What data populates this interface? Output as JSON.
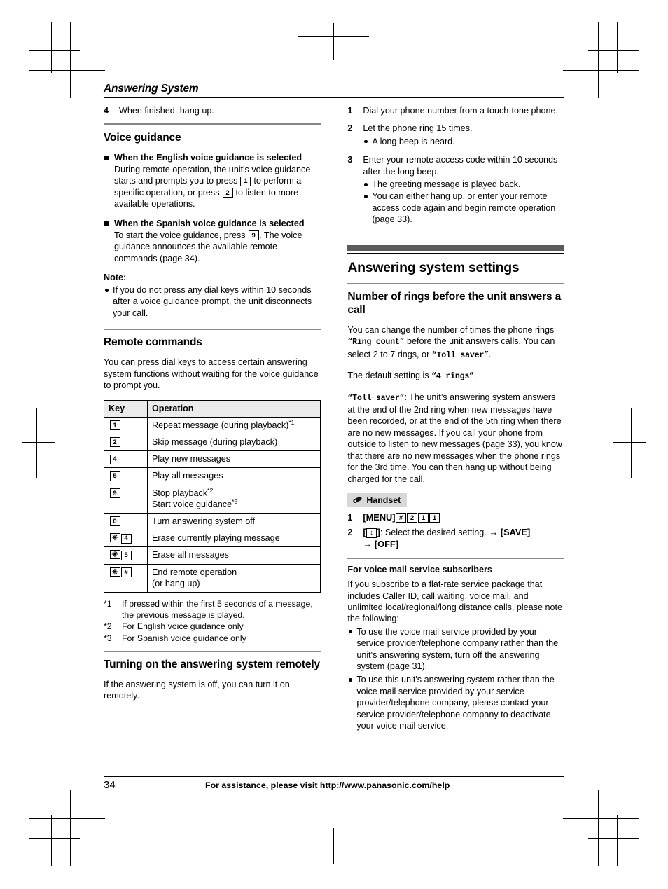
{
  "running_head": "Answering System",
  "left_column": {
    "step4": {
      "num": "4",
      "text": "When finished, hang up."
    },
    "voice_guidance": {
      "title": "Voice guidance",
      "blocks": [
        {
          "head": "When the English voice guidance is selected",
          "body_pre": "During remote operation, the unit's voice guidance starts and prompts you to press ",
          "key1": "1",
          "body_mid": " to perform a specific operation, or press ",
          "key2": "2",
          "body_post": " to listen to more available operations."
        },
        {
          "head": "When the Spanish voice guidance is selected",
          "body_pre": "To start the voice guidance, press ",
          "key1": "9",
          "body_post": ". The voice guidance announces the available remote commands (page 34)."
        }
      ],
      "note_label": "Note:",
      "note_items": [
        "If you do not press any dial keys within 10 seconds after a voice guidance prompt, the unit disconnects your call."
      ]
    },
    "remote_commands": {
      "title": "Remote commands",
      "intro": "You can press dial keys to access certain answering system functions without waiting for the voice guidance to prompt you.",
      "table": {
        "headers": [
          "Key",
          "Operation"
        ],
        "rows": [
          {
            "keys": [
              "1"
            ],
            "operation": "Repeat message (during playback)",
            "footnote": "*1"
          },
          {
            "keys": [
              "2"
            ],
            "operation": "Skip message (during playback)",
            "footnote": ""
          },
          {
            "keys": [
              "4"
            ],
            "operation": "Play new messages",
            "footnote": ""
          },
          {
            "keys": [
              "5"
            ],
            "operation": "Play all messages",
            "footnote": ""
          },
          {
            "keys": [
              "9"
            ],
            "operation": "Stop playback",
            "footnote": "*2",
            "operation2": "Start voice guidance",
            "footnote2": "*3"
          },
          {
            "keys": [
              "0"
            ],
            "operation": "Turn answering system off",
            "footnote": ""
          },
          {
            "keys": [
              "✳",
              "4"
            ],
            "operation": "Erase currently playing message",
            "footnote": ""
          },
          {
            "keys": [
              "✳",
              "5"
            ],
            "operation": "Erase all messages",
            "footnote": ""
          },
          {
            "keys": [
              "✳",
              "#"
            ],
            "operation": "End remote operation",
            "footnote": "",
            "operation2": "(or hang up)",
            "footnote2": ""
          }
        ]
      },
      "footnotes": [
        {
          "mark": "*1",
          "text": "If pressed within the first 5 seconds of a message, the previous message is played."
        },
        {
          "mark": "*2",
          "text": "For English voice guidance only"
        },
        {
          "mark": "*3",
          "text": "For Spanish voice guidance only"
        }
      ]
    },
    "turning_on": {
      "title": "Turning on the answering system remotely",
      "body": "If the answering system is off, you can turn it on remotely."
    }
  },
  "right_column": {
    "steps": [
      {
        "num": "1",
        "text": "Dial your phone number from a touch-tone phone.",
        "bullets": []
      },
      {
        "num": "2",
        "text": "Let the phone ring 15 times.",
        "bullets": [
          "A long beep is heard."
        ]
      },
      {
        "num": "3",
        "text": "Enter your remote access code within 10 seconds after the long beep.",
        "bullets": [
          "The greeting message is played back.",
          "You can either hang up, or enter your remote access code again and begin remote operation (page 33)."
        ]
      }
    ],
    "section_title": "Answering system settings",
    "rings": {
      "title": "Number of rings before the unit answers a call",
      "para1_a": "You can change the number of times the phone rings ",
      "para1_mono1": "“Ring count”",
      "para1_b": " before the unit answers calls. You can select 2 to 7 rings, or ",
      "para1_mono2": "“Toll saver”",
      "para1_c": ".",
      "para2_a": "The default setting is ",
      "para2_mono": "“4 rings”",
      "para2_b": ".",
      "para3_mono": "“Toll saver”",
      "para3_text": ": The unit’s answering system answers at the end of the 2nd ring when new messages have been recorded, or at the end of the 5th ring when there are no new messages. If you call your phone from outside to listen to new messages (page 33), you know that there are no new messages when the phone rings for the 3rd time. You can then hang up without being charged for the call."
    },
    "handset_badge": "Handset",
    "proc_steps": [
      {
        "num": "1",
        "label": "[MENU]",
        "keys": [
          "#",
          "2",
          "1",
          "1"
        ]
      },
      {
        "num": "2",
        "label_open": "[",
        "stepper": "↕",
        "label_close": "]",
        "text": ": Select the desired setting.",
        "arrow1": "→",
        "softkey1": "[SAVE]",
        "arrow2": "→",
        "softkey2": "[OFF]"
      }
    ],
    "voice_mail": {
      "title": "For voice mail service subscribers",
      "intro": "If you subscribe to a flat-rate service package that includes Caller ID, call waiting, voice mail, and unlimited local/regional/long distance calls, please note the following:",
      "bullets": [
        "To use the voice mail service provided by your service provider/telephone company rather than the unit's answering system, turn off the answering system (page 31).",
        "To use this unit's answering system rather than the voice mail service provided by your service provider/telephone company, please contact your service provider/telephone company to deactivate your voice mail service."
      ]
    }
  },
  "footer": {
    "page_number": "34",
    "assistance": "For assistance, please visit http://www.panasonic.com/help"
  }
}
